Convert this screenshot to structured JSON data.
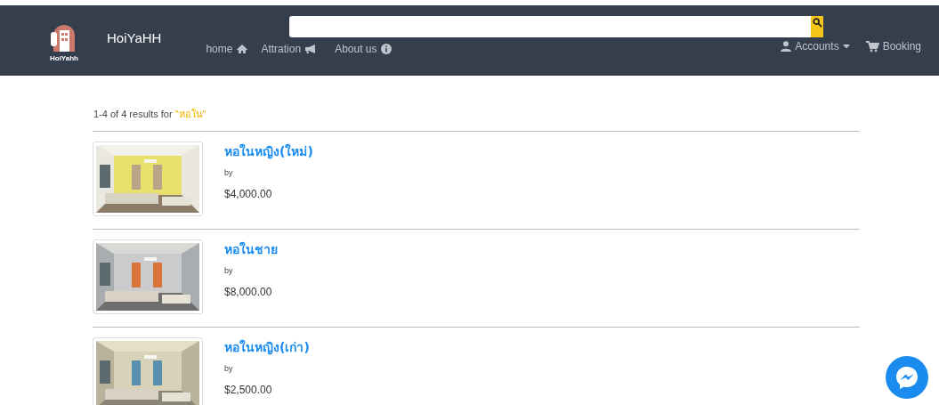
{
  "navbar": {
    "logo_caption": "HoiYahh",
    "brand": "HoiYaHH",
    "links": [
      {
        "label": "home"
      },
      {
        "label": "Attration"
      },
      {
        "label": "About us"
      }
    ],
    "right_links": [
      {
        "label": "Accounts"
      },
      {
        "label": "Booking"
      }
    ]
  },
  "results": {
    "summary": "1-4 of 4 results for ",
    "query": "\"หอใน\"",
    "items": [
      {
        "title": "หอในหญิง(ใหม่)",
        "by": "by",
        "price": "$4,000.00"
      },
      {
        "title": "หอในชาย",
        "by": "by",
        "price": "$8,000.00"
      },
      {
        "title": "หอในหญิง(เก่า)",
        "by": "by",
        "price": "$2,500.00"
      }
    ]
  }
}
